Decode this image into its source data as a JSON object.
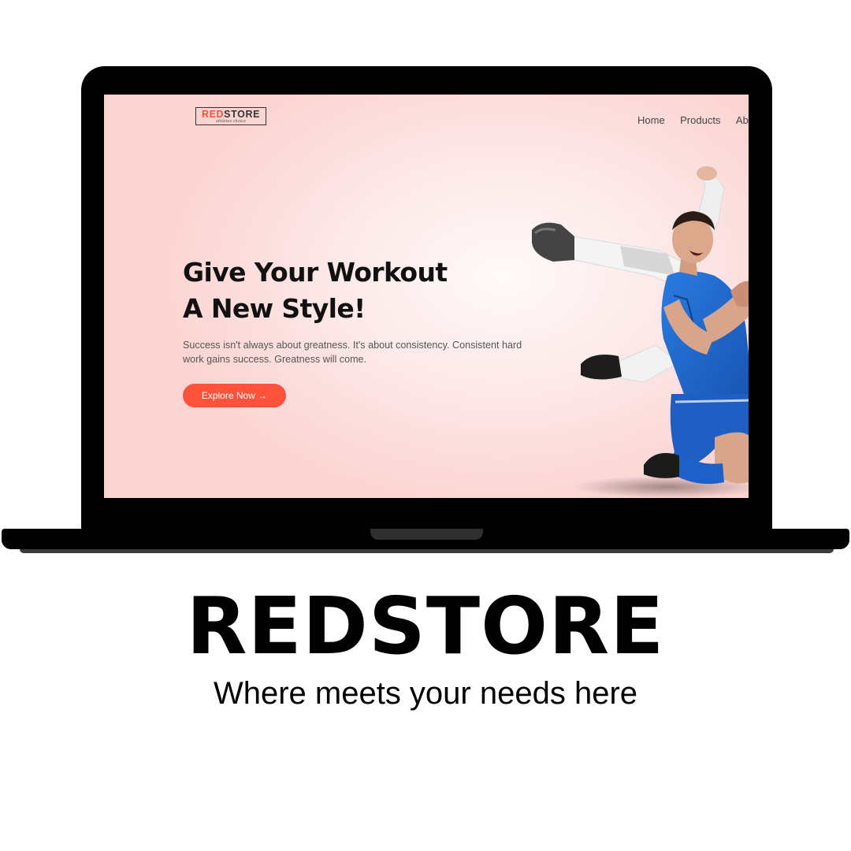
{
  "site": {
    "logo": {
      "red_part": "RED",
      "dark_part": "STORE",
      "subtitle": "athletes choice"
    },
    "nav": {
      "items": [
        "Home",
        "Products",
        "About"
      ]
    },
    "hero": {
      "title_line1": "Give Your Workout",
      "title_line2": "A New Style!",
      "description": "Success isn't always about greatness. It's about consistency. Consistent hard work gains success. Greatness will come.",
      "button_label": "Explore Now →"
    }
  },
  "caption": {
    "title": "REDSTORE",
    "tagline": "Where meets your needs here"
  },
  "colors": {
    "accent": "#ff523b",
    "frame": "#000000",
    "jersey": "#1a63c9"
  },
  "icons": {
    "button_arrow": "arrow-right-icon"
  }
}
